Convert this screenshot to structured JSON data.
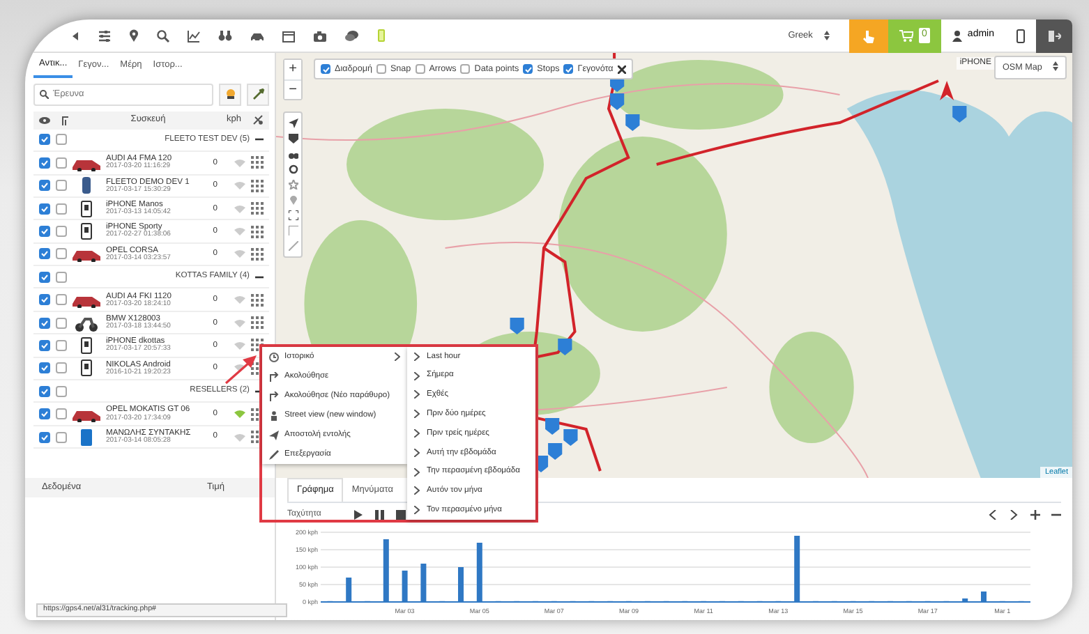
{
  "toolbar": {
    "language": "Greek",
    "cart_count": "0",
    "user": "admin"
  },
  "sidebar": {
    "tabs": [
      {
        "label": "Αντικ...",
        "selected": true
      },
      {
        "label": "Γεγον...",
        "selected": false
      },
      {
        "label": "Μέρη",
        "selected": false
      },
      {
        "label": "Ιστορ...",
        "selected": false
      }
    ],
    "search": {
      "placeholder": "Έρευνα"
    },
    "columns": [
      "Συσκευή",
      "kph"
    ],
    "groups": [
      {
        "name": "FLEETO TEST DEV (5)",
        "visible": true,
        "followed": false,
        "devices": [
          {
            "kind": "car",
            "name": "AUDI A4 FMA 120",
            "time": "2017-03-20 11:16:29",
            "speed": "0",
            "visible": true,
            "followed": false,
            "online": false
          },
          {
            "kind": "tracker",
            "name": "FLEETO DEMO DEV 1",
            "time": "2017-03-17 15:30:29",
            "speed": "0",
            "visible": true,
            "followed": false,
            "online": false
          },
          {
            "kind": "phone",
            "name": "iPHONE Manos",
            "time": "2017-03-13 14:05:42",
            "speed": "0",
            "visible": true,
            "followed": false,
            "online": false
          },
          {
            "kind": "phone",
            "name": "iPHONE Sporty",
            "time": "2017-02-27 01:38:06",
            "speed": "0",
            "visible": true,
            "followed": false,
            "online": false
          },
          {
            "kind": "car",
            "name": "OPEL CORSA",
            "time": "2017-03-14 03:23:57",
            "speed": "0",
            "visible": true,
            "followed": false,
            "online": false
          }
        ]
      },
      {
        "name": "KOTTAS FAMILY (4)",
        "visible": true,
        "followed": false,
        "devices": [
          {
            "kind": "car",
            "name": "AUDI A4 FKI 1120",
            "time": "2017-03-20 18:24:10",
            "speed": "0",
            "visible": true,
            "followed": false,
            "online": false
          },
          {
            "kind": "motorbike",
            "name": "BMW X128003",
            "time": "2017-03-18 13:44:50",
            "speed": "0",
            "visible": true,
            "followed": false,
            "online": false
          },
          {
            "kind": "phone",
            "name": "iPHONE dkottas",
            "time": "2017-03-17 20:57:33",
            "speed": "0",
            "visible": true,
            "followed": false,
            "online": false
          },
          {
            "kind": "phone",
            "name": "NIKOLAS Android",
            "time": "2016-10-21 19:20:23",
            "speed": "0",
            "visible": true,
            "followed": false,
            "online": false
          }
        ]
      },
      {
        "name": "RESELLERS (2)",
        "visible": true,
        "followed": false,
        "devices": [
          {
            "kind": "car",
            "name": "OPEL MOKATIS GT 06",
            "time": "2017-03-20 17:34:09",
            "speed": "0",
            "visible": true,
            "followed": false,
            "online": true
          },
          {
            "kind": "tablet",
            "name": "ΜΑΝΩΛΗΣ ΣΥΝΤΑΚΗΣ",
            "time": "2017-03-14 08:05:28",
            "speed": "0",
            "visible": true,
            "followed": false,
            "online": false
          }
        ]
      }
    ]
  },
  "map": {
    "layers": [
      {
        "label": "Διαδρομή",
        "checked": true
      },
      {
        "label": "Snap",
        "checked": false
      },
      {
        "label": "Arrows",
        "checked": false
      },
      {
        "label": "Data points",
        "checked": false
      },
      {
        "label": "Stops",
        "checked": true
      },
      {
        "label": "Γεγονότα",
        "checked": true
      }
    ],
    "zoom_controls": [
      "+",
      "−"
    ],
    "vehicle_label": "iPHONE",
    "base_map": "OSM Map",
    "attribution": "Leaflet"
  },
  "context_menu": {
    "items": [
      {
        "label": "Ιστορικό",
        "submenu": true
      },
      {
        "label": "Ακολούθησε",
        "submenu": false
      },
      {
        "label": "Ακολούθησε (Νέο παράθυρο)",
        "submenu": false
      },
      {
        "label": "Street view (new window)",
        "submenu": false
      },
      {
        "label": "Αποστολή εντολής",
        "submenu": false
      },
      {
        "label": "Επεξεργασία",
        "submenu": false
      }
    ],
    "submenu": [
      "Last hour",
      "Σήμερα",
      "Εχθές",
      "Πριν δύο ημέρες",
      "Πριν τρείς ημέρες",
      "Αυτή την εβδομάδα",
      "Την περασμένη εβδομάδα",
      "Αυτόν τον μήνα",
      "Τον περασμένο μήνα"
    ]
  },
  "bottom": {
    "data_columns": [
      "Δεδομένα",
      "Τιμή"
    ],
    "tabs": [
      {
        "label": "Γράφημα",
        "selected": true
      },
      {
        "label": "Μηνύματα",
        "selected": false
      }
    ],
    "series_select": "Ταχύτητα",
    "chart_data": {
      "type": "bar",
      "categories": [
        null,
        null,
        null,
        null,
        "Mar 03",
        null,
        null,
        null,
        "Mar 05",
        null,
        null,
        null,
        "Mar 07",
        null,
        null,
        null,
        "Mar 09",
        null,
        null,
        null,
        "Mar 11",
        null,
        null,
        null,
        "Mar 13",
        null,
        null,
        null,
        "Mar 15",
        null,
        null,
        null,
        "Mar 17",
        null,
        null,
        null,
        "Mar 1",
        null
      ],
      "series": [
        {
          "color": "#2f78c4",
          "values": [
            0,
            70,
            0,
            180,
            90,
            110,
            0,
            100,
            170,
            0,
            0,
            0,
            0,
            0,
            0,
            0,
            0,
            0,
            0,
            0,
            0,
            0,
            0,
            0,
            0,
            190,
            0,
            0,
            0,
            0,
            0,
            0,
            0,
            0,
            10,
            30,
            0,
            0
          ]
        }
      ],
      "ylim": [
        0,
        200
      ],
      "grid": true,
      "yticks": [
        {
          "value": 0,
          "label": "0 kph"
        },
        {
          "value": 50,
          "label": "50 kph"
        },
        {
          "value": 100,
          "label": "100 kph"
        },
        {
          "value": 150,
          "label": "150 kph"
        },
        {
          "value": 200,
          "label": "200 kph"
        }
      ]
    }
  },
  "status_bar": "https://gps4.net/al31/tracking.php#"
}
